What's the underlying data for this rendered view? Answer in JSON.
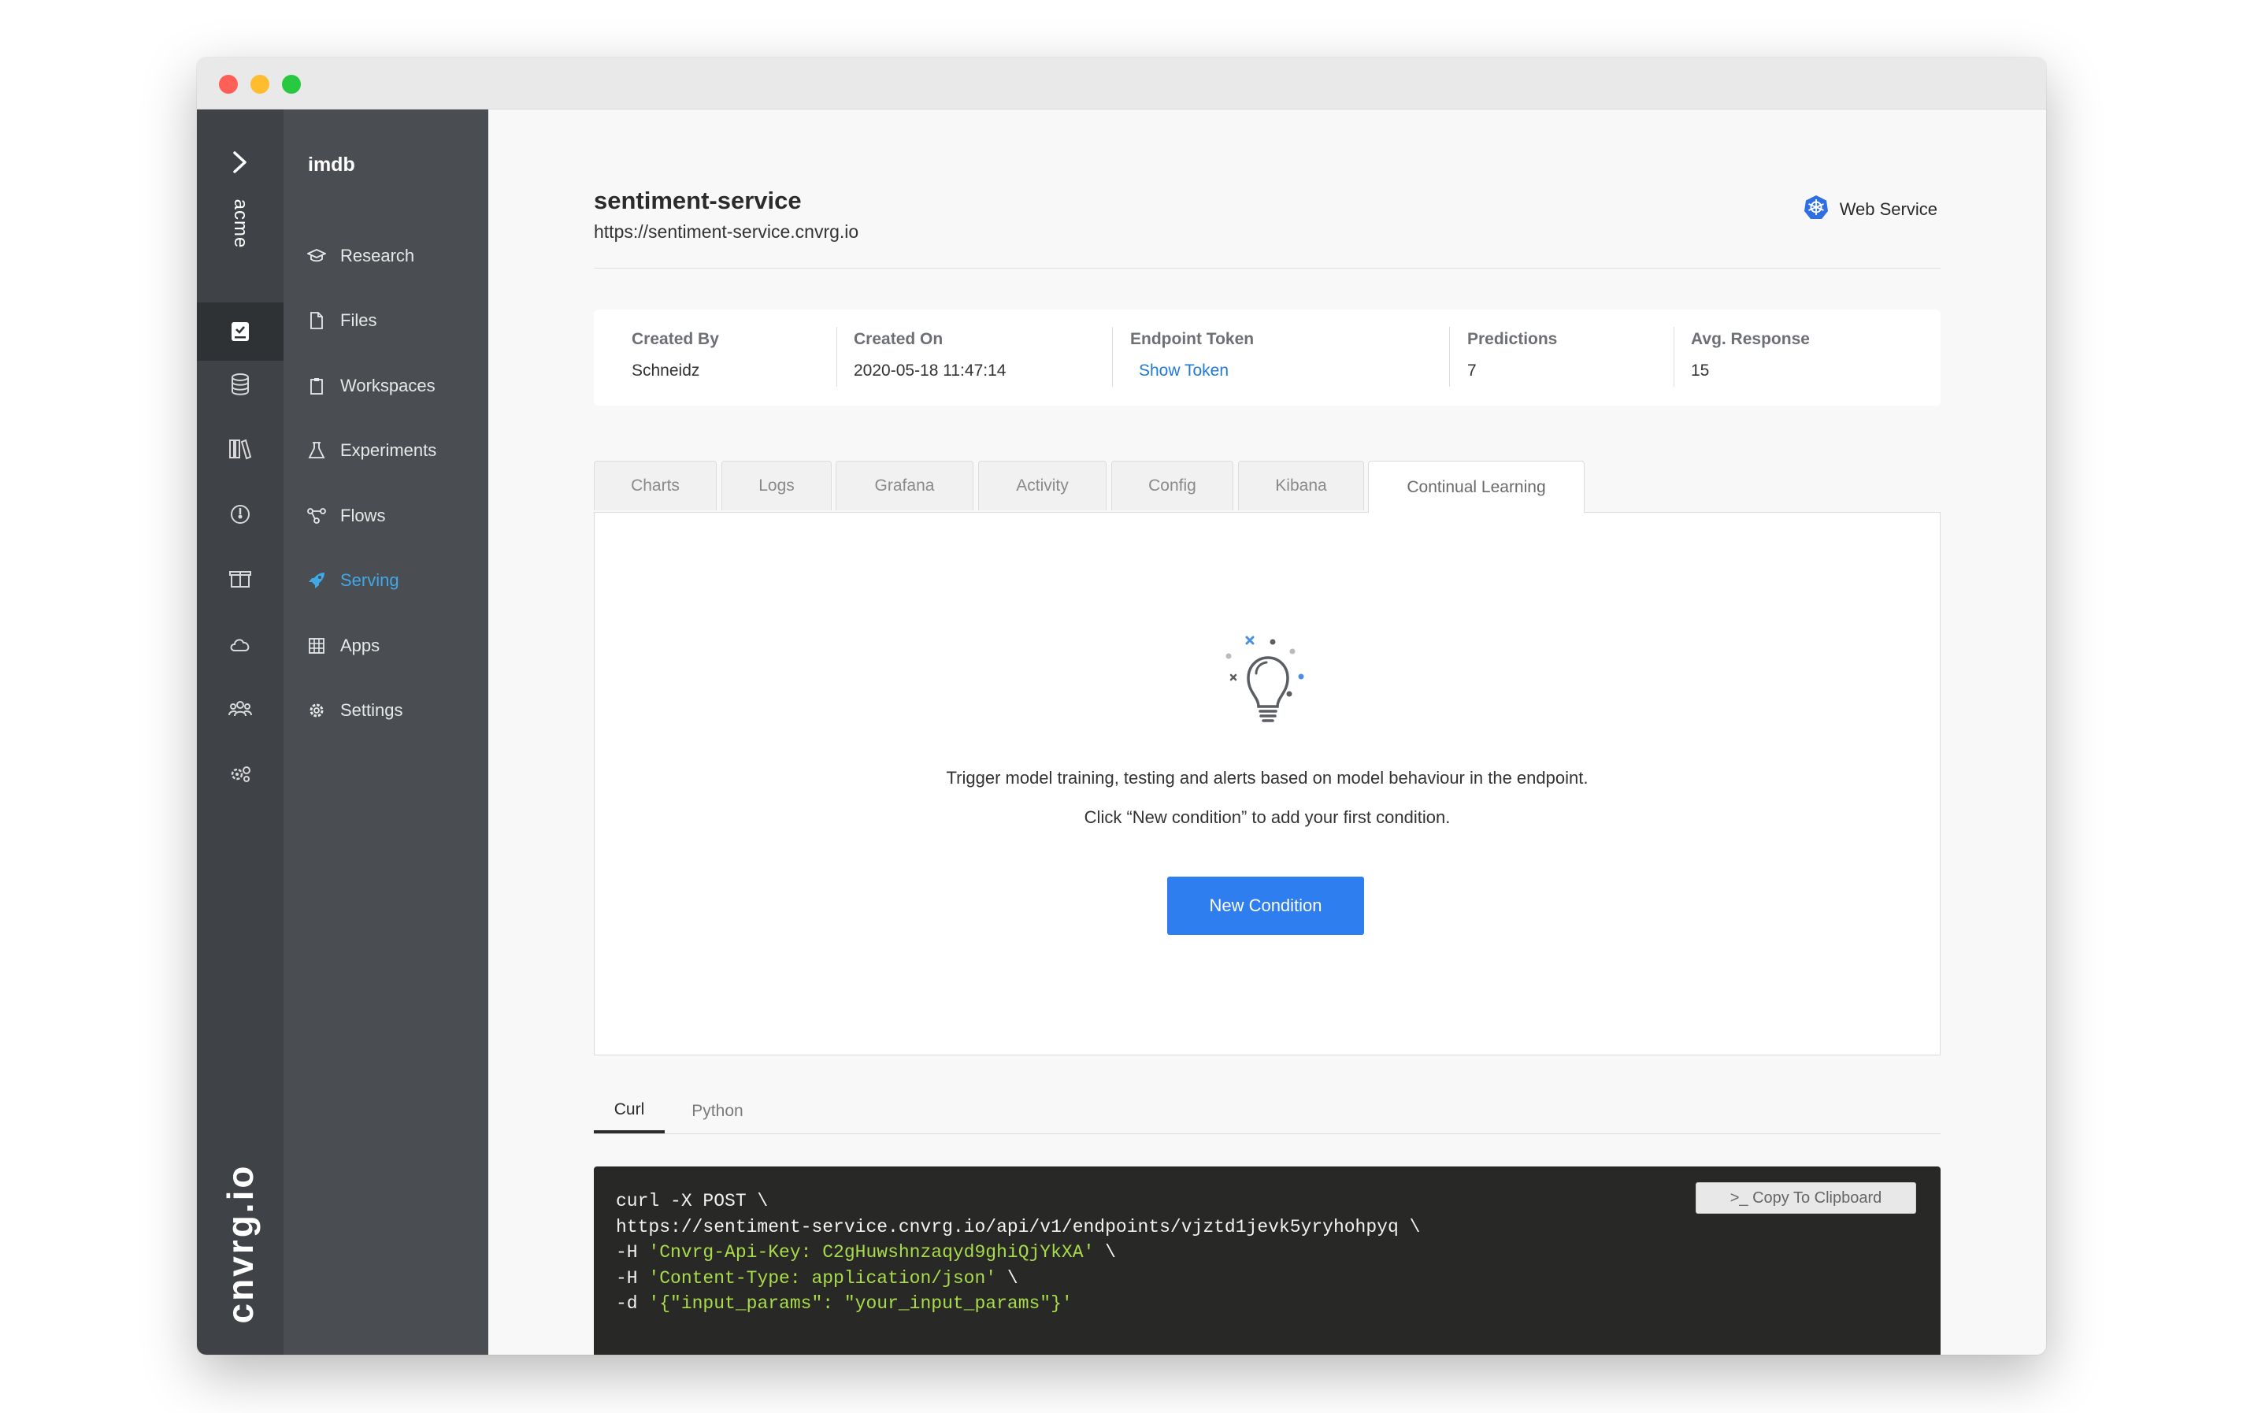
{
  "sidebar": {
    "org": "acme",
    "brand": "cnvrg.io",
    "project": "imdb",
    "items": [
      {
        "label": "Research",
        "icon": "graduation-cap-icon"
      },
      {
        "label": "Files",
        "icon": "file-icon"
      },
      {
        "label": "Workspaces",
        "icon": "clipboard-icon"
      },
      {
        "label": "Experiments",
        "icon": "flask-icon"
      },
      {
        "label": "Flows",
        "icon": "flow-icon"
      },
      {
        "label": "Serving",
        "icon": "rocket-icon",
        "active": true
      },
      {
        "label": "Apps",
        "icon": "grid-icon"
      },
      {
        "label": "Settings",
        "icon": "gear-icon"
      }
    ],
    "rail_icons": [
      "projects-icon",
      "datasets-icon",
      "library-icon",
      "dashboard-icon",
      "containers-icon",
      "cloud-icon",
      "members-icon",
      "org-settings-icon"
    ]
  },
  "service": {
    "name": "sentiment-service",
    "url": "https://sentiment-service.cnvrg.io",
    "type": "Web Service"
  },
  "stats": [
    {
      "label": "Created By",
      "value": "Schneidz"
    },
    {
      "label": "Created On",
      "value": "2020-05-18 11:47:14"
    },
    {
      "label": "Endpoint Token",
      "value": "Show Token"
    },
    {
      "label": "Predictions",
      "value": "7"
    },
    {
      "label": "Avg. Response",
      "value": "15"
    }
  ],
  "tabs": [
    "Charts",
    "Logs",
    "Grafana",
    "Activity",
    "Config",
    "Kibana",
    "Continual Learning"
  ],
  "active_tab": "Continual Learning",
  "continual_learning": {
    "description": "Trigger model training, testing and alerts based on model behaviour in the endpoint.",
    "hint": "Click “New condition” to add your first condition.",
    "button": "New Condition"
  },
  "code": {
    "tabs": [
      "Curl",
      "Python"
    ],
    "active": "Curl",
    "copy_button": ">_ Copy To Clipboard",
    "lines": [
      {
        "cmd": "curl -X POST \\",
        "str": "",
        "tail": ""
      },
      {
        "cmd": "https://sentiment-service.cnvrg.io/api/v1/endpoints/vjztd1jevk5yryhohpyq \\",
        "str": "",
        "tail": ""
      },
      {
        "cmd": "-H ",
        "str": "'Cnvrg-Api-Key: C2gHuwshnzaqyd9ghiQjYkXA'",
        "tail": " \\"
      },
      {
        "cmd": "-H ",
        "str": "'Content-Type: application/json'",
        "tail": " \\"
      },
      {
        "cmd": "-d ",
        "str": "'{\"input_params\": \"your_input_params\"}'",
        "tail": ""
      }
    ]
  },
  "colors": {
    "accent": "#2f7ef0",
    "link": "#1f7ad8",
    "active_nav": "#41a8e6",
    "code_string": "#a9dc4b"
  }
}
